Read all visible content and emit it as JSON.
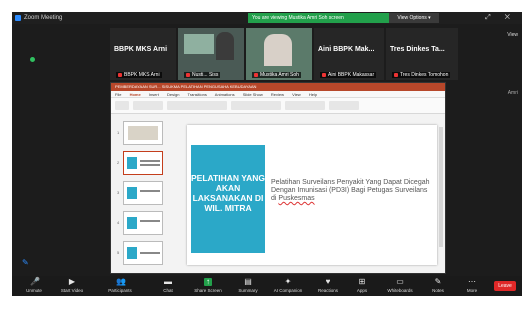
{
  "zoom": {
    "window_title": "Zoom Meeting",
    "banner": "You are viewing Mustika Amri Soh screen",
    "view_options": "View Options",
    "view_button": "View",
    "side_name": "Amri"
  },
  "participants": [
    {
      "name": "BBPK MKS Arni",
      "label": "BBPK MKS Arni"
    },
    {
      "name": "",
      "label": "Nusti... Siss"
    },
    {
      "name": "",
      "label": "Mustika Amri Soh"
    },
    {
      "name": "Aini BBPK Mak...",
      "label": "Aini BBPK Makassar"
    },
    {
      "name": "Tres Dinkes Ta...",
      "label": "Tres Dinkes Tomohon"
    }
  ],
  "ppt": {
    "title": "PEMBERDAYAAN SUR... SISUKMA PELATIHAN PENGUSAHA KEBUDAYAAN",
    "tabs": [
      "File",
      "Home",
      "Insert",
      "Design",
      "Transitions",
      "Animations",
      "Slide Show",
      "Review",
      "View",
      "Help"
    ],
    "active_tab": "Home",
    "slide_block_text": "PELATIHAN YANG AKAN LAKSANAKAN DI WIL. MITRA",
    "slide_body_text": "Pelatihan Surveilans Penyakit Yang Dapat Dicegah Dengan Imunisasi (PD3I) Bagi Petugas Surveilans di ",
    "slide_body_underlined": "Puskesmas",
    "thumb_numbers": [
      "1",
      "2",
      "3",
      "4",
      "5"
    ]
  },
  "toolbar": {
    "unmute": "Unmute",
    "start_video": "Start Video",
    "participants": "Participants",
    "participant_count": "8",
    "chat": "Chat",
    "share_screen": "Share Screen",
    "summary": "Summary",
    "ai_companion": "AI Companion",
    "reactions": "Reactions",
    "apps": "Apps",
    "whiteboards": "Whiteboards",
    "notes": "Notes",
    "more": "More",
    "leave": "Leave"
  },
  "colors": {
    "slide_accent": "#2ba8c8",
    "ppt_brand": "#b7472a",
    "banner_green": "#22a04b",
    "leave_red": "#e02828"
  }
}
